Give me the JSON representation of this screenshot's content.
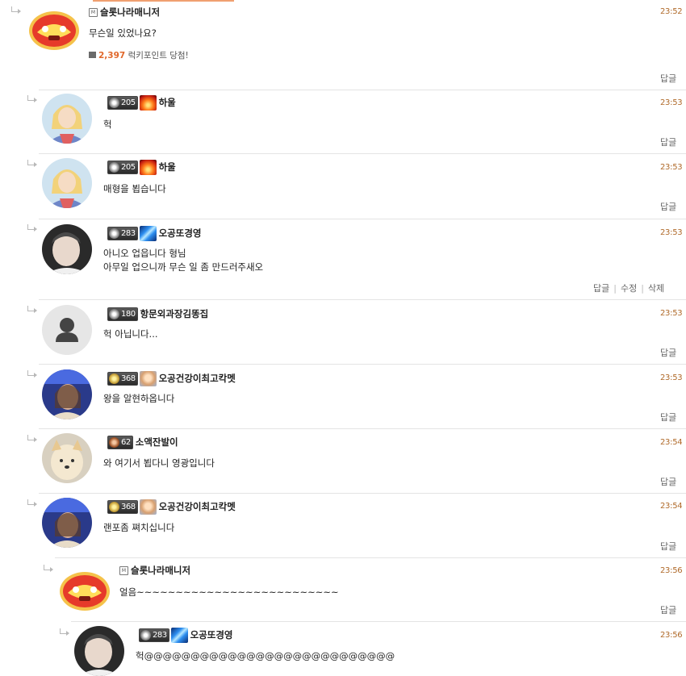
{
  "comments": [
    {
      "nickname": "슬롯나라매니저",
      "time": "23:52",
      "text": [
        "무슨일 있었나요?"
      ],
      "reward": {
        "points": "2,397",
        "label": "럭키포인트 당첨!"
      },
      "reply": "답글"
    },
    {
      "level": "205",
      "nickname": "하울",
      "time": "23:53",
      "text": [
        "헉"
      ],
      "reply": "답글"
    },
    {
      "level": "205",
      "nickname": "하울",
      "time": "23:53",
      "text": [
        "매형을 뵙습니다"
      ],
      "reply": "답글"
    },
    {
      "level": "283",
      "nickname": "오공또경영",
      "time": "23:53",
      "text": [
        "아니오 업읍니다 형님",
        "아무일 업으니까 무슨 일 좀 만드러주새오"
      ],
      "reply": "답글",
      "edit": "수정",
      "delete": "삭제"
    },
    {
      "level": "180",
      "nickname": "항문외과장김똥집",
      "time": "23:53",
      "text": [
        "헉 아닙니다..."
      ],
      "reply": "답글"
    },
    {
      "level": "368",
      "nickname": "오공건강이최고칵멧",
      "time": "23:53",
      "text": [
        "왕을 알현하옵니다"
      ],
      "reply": "답글"
    },
    {
      "level": "62",
      "nickname": "소액잔발이",
      "time": "23:54",
      "text": [
        "와 여기서 뵙다니 영광입니다"
      ],
      "reply": "답글"
    },
    {
      "level": "368",
      "nickname": "오공건강이최고칵멧",
      "time": "23:54",
      "text": [
        "랜포좀 쪄치십니다"
      ],
      "reply": "답글"
    },
    {
      "nickname": "슬롯나라매니저",
      "time": "23:56",
      "text": [
        "얼음~~~~~~~~~~~~~~~~~~~~~~~~~~"
      ],
      "reply": "답글"
    },
    {
      "level": "283",
      "nickname": "오공또경영",
      "time": "23:56",
      "text": [
        "헉@@@@@@@@@@@@@@@@@@@@@@@@@@@"
      ]
    }
  ],
  "colors": {
    "time": "#b06a2a",
    "points": "#e0672a",
    "divider": "#e4e4e4"
  }
}
